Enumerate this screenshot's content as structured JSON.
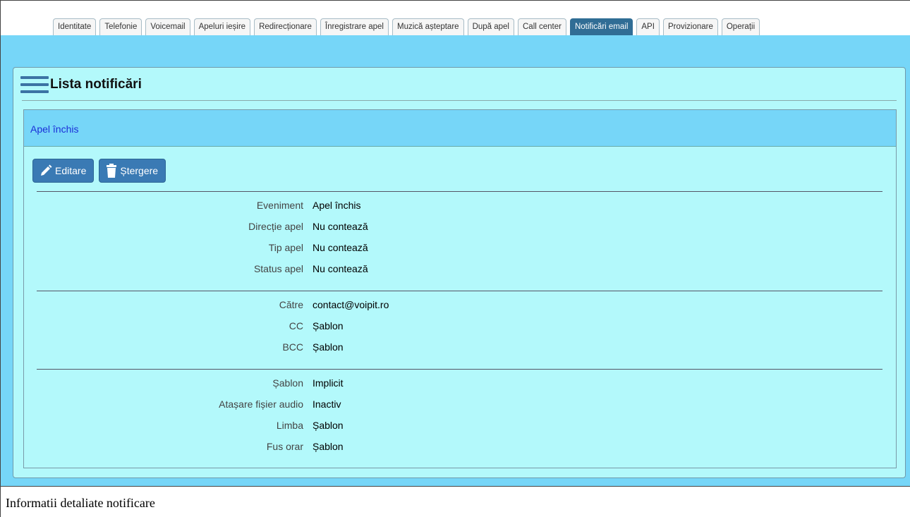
{
  "tabs": [
    {
      "label": "Identitate"
    },
    {
      "label": "Telefonie"
    },
    {
      "label": "Voicemail"
    },
    {
      "label": "Apeluri ieșire"
    },
    {
      "label": "Redirecționare"
    },
    {
      "label": "Înregistrare apel"
    },
    {
      "label": "Muzică așteptare"
    },
    {
      "label": "După apel"
    },
    {
      "label": "Call center"
    },
    {
      "label": "Notificări email",
      "active": true
    },
    {
      "label": "API"
    },
    {
      "label": "Provizionare"
    },
    {
      "label": "Operații"
    }
  ],
  "panel": {
    "title": "Lista notificări",
    "icon": "menu-icon"
  },
  "notification": {
    "name": "Apel închis",
    "edit_label": "Editare",
    "delete_label": "Ștergere",
    "edit_icon": "pencil-icon",
    "delete_icon": "trash-icon",
    "groups": [
      [
        {
          "label": "Eveniment",
          "value": "Apel închis"
        },
        {
          "label": "Direcție apel",
          "value": "Nu contează"
        },
        {
          "label": "Tip apel",
          "value": "Nu contează"
        },
        {
          "label": "Status apel",
          "value": "Nu contează"
        }
      ],
      [
        {
          "label": "Către",
          "value": "contact@voipit.ro"
        },
        {
          "label": "CC",
          "value": "Șablon"
        },
        {
          "label": "BCC",
          "value": "Șablon"
        }
      ],
      [
        {
          "label": "Șablon",
          "value": "Implicit"
        },
        {
          "label": "Atașare fișier audio",
          "value": "Inactiv"
        },
        {
          "label": "Limba",
          "value": "Șablon"
        },
        {
          "label": "Fus orar",
          "value": "Șablon"
        }
      ]
    ]
  },
  "caption": "Informatii detaliate notificare",
  "colors": {
    "accent": "#306d95",
    "page_bg": "#76d6f8",
    "panel_bg": "#b3f9fb",
    "button": "#3a7ab4",
    "link": "#1a2fd8"
  }
}
